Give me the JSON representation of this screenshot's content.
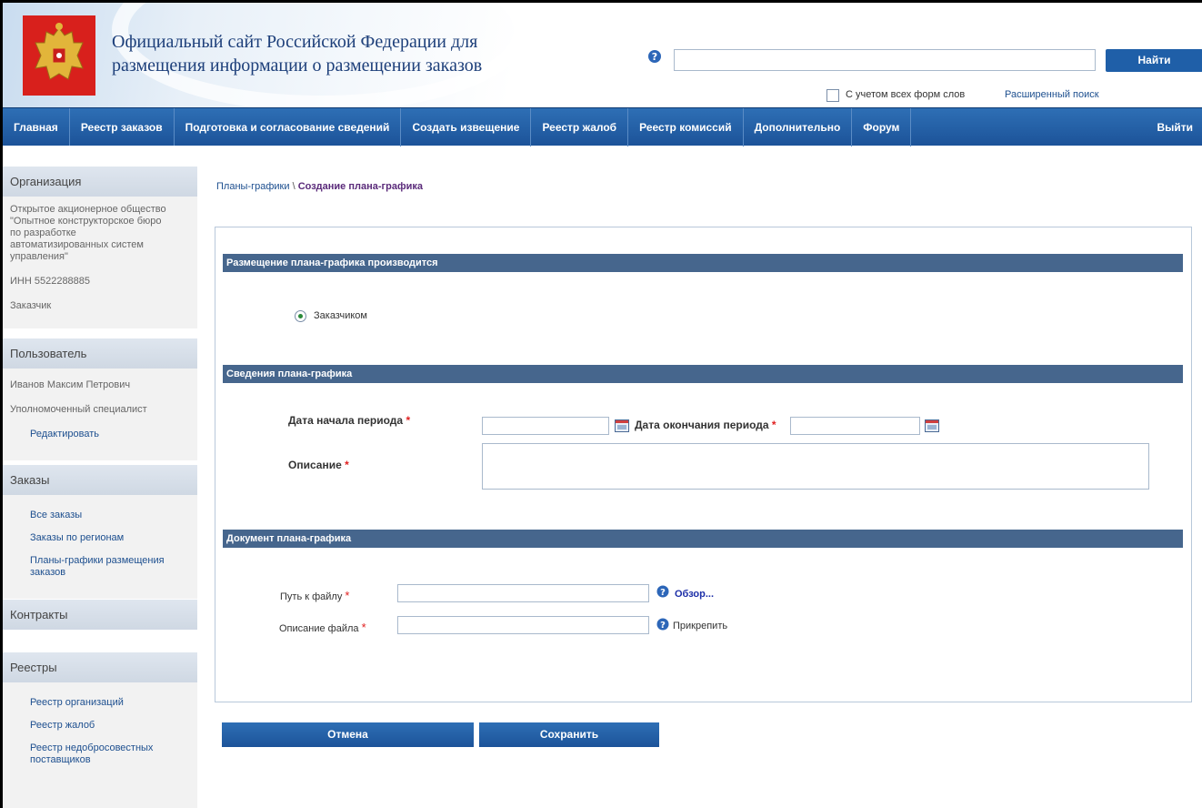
{
  "header": {
    "title_line1": "Официальный сайт Российской Федерации для",
    "title_line2": "размещения информации о размещении заказов",
    "search_button": "Найти",
    "search_value": "",
    "all_forms_label": "С учетом всех форм слов",
    "advanced_search": "Расширенный поиск",
    "help_icon": "help-icon",
    "emblem_icon": "coat-of-arms-icon"
  },
  "nav": {
    "items": [
      "Главная",
      "Реестр заказов",
      "Подготовка и согласование сведений",
      "Создать извещение",
      "Реестр жалоб",
      "Реестр комиссий",
      "Дополнительно",
      "Форум"
    ],
    "exit": "Выйти"
  },
  "sidebar": {
    "org": {
      "title": "Организация",
      "name": "Открытое акционерное общество \"Опытное конструкторское бюро по разработке автоматизированных систем управления\"",
      "inn": "ИНН 5522288885",
      "role": "Заказчик"
    },
    "user": {
      "title": "Пользователь",
      "name": "Иванов Максим Петрович",
      "role": "Уполномоченный специалист",
      "edit": "Редактировать"
    },
    "orders": {
      "title": "Заказы",
      "links": [
        "Все заказы",
        "Заказы по регионам",
        "Планы-графики размещения заказов"
      ]
    },
    "contracts": {
      "title": "Контракты"
    },
    "registries": {
      "title": "Реестры",
      "links": [
        "Реестр организаций",
        "Реестр жалоб",
        "Реестр недобросовестных поставщиков"
      ]
    }
  },
  "breadcrumb": {
    "parent": "Планы-графики",
    "separator": "\\",
    "current": "Создание плана-графика"
  },
  "form": {
    "section1": "Размещение плана-графика производится",
    "radio_label": "Заказчиком",
    "section2": "Сведения плана-графика",
    "start_date_label": "Дата начала периода",
    "end_date_label": "Дата окончания периода",
    "description_label": "Описание",
    "required_mark": "*",
    "section3": "Документ плана-графика",
    "file_path_label": "Путь к файлу",
    "file_desc_label": "Описание файла",
    "browse": "Обзор...",
    "attach": "Прикрепить"
  },
  "buttons": {
    "cancel": "Отмена",
    "save": "Сохранить"
  },
  "colors": {
    "nav_blue": "#1f5fa8",
    "section_bar": "#46668d",
    "link": "#1d4f8f",
    "required": "#e02020"
  }
}
